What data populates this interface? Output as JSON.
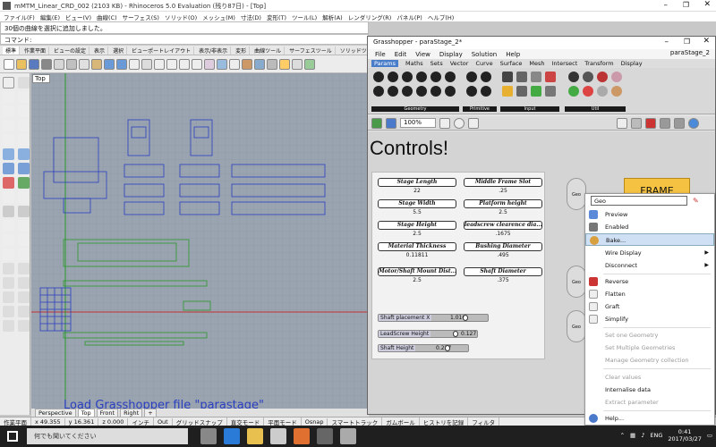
{
  "rhino": {
    "title": "mMTM_Linear_CRD_002 (2103 KB) - Rhinoceros 5.0 Evaluation (残り87日) - [Top]",
    "menu": [
      "ファイル(F)",
      "編集(E)",
      "ビュー(V)",
      "曲線(C)",
      "サーフェス(S)",
      "ソリッド(O)",
      "メッシュ(M)",
      "寸法(D)",
      "変形(T)",
      "ツール(L)",
      "解析(A)",
      "レンダリング(R)",
      "パネル(P)",
      "ヘルプ(H)"
    ],
    "command_history": "30個の曲線を選択に追加しました。",
    "command_prompt": "コマンド:",
    "toolbar_tabs": [
      "標準",
      "作業平面",
      "ビューの設定",
      "表示",
      "選択",
      "ビューポートレイアウト",
      "表示/非表示",
      "変形",
      "曲線ツール",
      "サーフェスツール",
      "ソリッドツール"
    ],
    "viewport_label": "Top",
    "viewport_overlay_text": "Load Grasshopper file \"parastage\"",
    "viewport_tabs": [
      "Perspective",
      "Top",
      "Front",
      "Right",
      "+"
    ],
    "active_viewport_tab": "Top",
    "status": {
      "cplane": "作業平面",
      "x": "x 49.355",
      "y": "y 16.361",
      "z": "z 0.000",
      "units": "インチ",
      "layer": "Out",
      "grid_snap": "グリッドスナップ",
      "ortho": "直交モード",
      "planar": "平面モード",
      "osnap": "Osnap",
      "smarttrack": "スマートトラック",
      "gumball": "ガムボール",
      "history": "ヒストリを記録",
      "filter": "フィルタ"
    }
  },
  "taskbar": {
    "search_placeholder": "何でも聞いてください",
    "time": "0:41",
    "date": "2017/03/27",
    "lang": "ENG"
  },
  "grasshopper": {
    "title": "Grasshopper - paraStage_2*",
    "menu": [
      "File",
      "Edit",
      "View",
      "Display",
      "Solution",
      "Help"
    ],
    "doc_name": "paraStage_2",
    "tabs": [
      "Params",
      "Maths",
      "Sets",
      "Vector",
      "Curve",
      "Surface",
      "Mesh",
      "Intersect",
      "Transform",
      "Display"
    ],
    "active_tab": "Params",
    "ribbon_groups": [
      "Geometry",
      "Primitive",
      "Input",
      "Util"
    ],
    "zoom": "100%",
    "canvas_title": "Controls!",
    "params": [
      {
        "label": "Stage Length",
        "value": "22"
      },
      {
        "label": "Middle Frame Slot",
        "value": ".25"
      },
      {
        "label": "Stage Width",
        "value": "5.5"
      },
      {
        "label": "Platform height",
        "value": "2.5"
      },
      {
        "label": "Stage Height",
        "value": "2.5"
      },
      {
        "label": "leadscrew clearence dia...",
        "value": ".1675"
      },
      {
        "label": "Material Thickness",
        "value": "0.11811"
      },
      {
        "label": "Bushing Diameter",
        "value": ".495"
      },
      {
        "label": "Motor/Shaft Mount Dist...",
        "value": "2.5"
      },
      {
        "label": "Shaft Diameter",
        "value": ".375"
      }
    ],
    "sliders": [
      {
        "name": "Shaft placement X",
        "value": "1.016",
        "level": 0.45
      },
      {
        "name": "LeadScrew Height",
        "value": "0.127",
        "level": 0.4
      },
      {
        "name": "Shaft Height",
        "value": "0.237",
        "level": 0.35
      }
    ],
    "nodes": [
      "Geo",
      "Geo",
      "Geo"
    ],
    "frame_button": "FRAME"
  },
  "context_menu": {
    "input_value": "Geo",
    "items": [
      {
        "label": "Preview",
        "icon": "preview-icon",
        "enabled": true
      },
      {
        "label": "Enabled",
        "icon": "enabled-icon",
        "enabled": true
      },
      {
        "label": "Bake...",
        "icon": "bake-icon",
        "enabled": true,
        "highlighted": true
      },
      {
        "label": "Wire Display",
        "icon": "",
        "enabled": true,
        "submenu": true
      },
      {
        "label": "Disconnect",
        "icon": "",
        "enabled": true,
        "submenu": true
      },
      {
        "label": "Reverse",
        "icon": "reverse-icon",
        "enabled": true
      },
      {
        "label": "Flatten",
        "icon": "flatten-icon",
        "enabled": true
      },
      {
        "label": "Graft",
        "icon": "graft-icon",
        "enabled": true
      },
      {
        "label": "Simplify",
        "icon": "simplify-icon",
        "enabled": true
      },
      {
        "label": "Set one Geometry",
        "icon": "",
        "enabled": false
      },
      {
        "label": "Set Multiple Geometries",
        "icon": "",
        "enabled": false
      },
      {
        "label": "Manage Geometry collection",
        "icon": "",
        "enabled": false
      },
      {
        "label": "Clear values",
        "icon": "",
        "enabled": false
      },
      {
        "label": "Internalise data",
        "icon": "",
        "enabled": true
      },
      {
        "label": "Extract parameter",
        "icon": "",
        "enabled": false
      },
      {
        "label": "Help...",
        "icon": "help-icon",
        "enabled": true
      }
    ]
  },
  "colors": {
    "viewport_bg": "#9aa3b0",
    "geometry_blue": "#2a3fbf",
    "geometry_green": "#2a9a2a",
    "axis_red": "#c03030",
    "frame_button": "#f5c242",
    "menu_highlight": "#cfe0f5"
  }
}
